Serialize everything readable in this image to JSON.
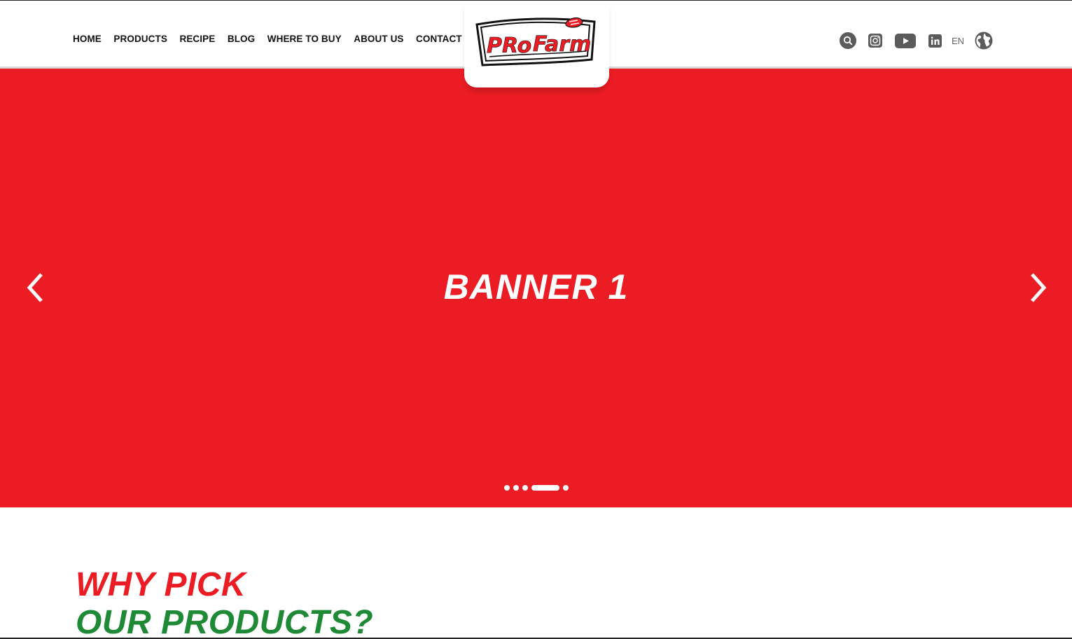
{
  "brand": {
    "logo_text_pro": "PRo",
    "logo_text_farm": "Farm",
    "red": "#ec1c24",
    "green": "#1f8a36"
  },
  "nav": {
    "items": [
      {
        "label": "HOME"
      },
      {
        "label": "PRODUCTS"
      },
      {
        "label": "RECIPE"
      },
      {
        "label": "BLOG"
      },
      {
        "label": "WHERE TO BUY"
      },
      {
        "label": "ABOUT US"
      },
      {
        "label": "CONTACT"
      }
    ]
  },
  "header_icons": [
    "search-icon",
    "instagram-icon",
    "youtube-icon",
    "linkedin-icon",
    "globe-icon"
  ],
  "language": {
    "current": "EN"
  },
  "banner": {
    "title": "BANNER 1",
    "background": "#ec1c24",
    "slide_count": 5,
    "active_slide": 4
  },
  "section": {
    "heading_line1": "WHY PICK",
    "heading_line2": "OUR PRODUCTS?"
  }
}
